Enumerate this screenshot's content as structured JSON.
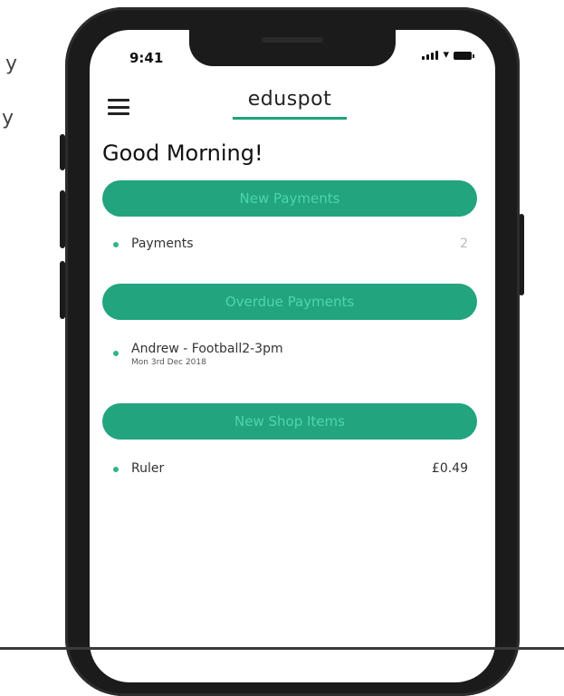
{
  "background_fragments": [
    "y",
    "y"
  ],
  "status_bar": {
    "time": "9:41",
    "signal_icon": "cellular-signal-icon",
    "wifi_icon": "wifi-icon",
    "battery_icon": "battery-icon"
  },
  "header": {
    "menu_icon": "hamburger-menu-icon",
    "logo": "eduspot"
  },
  "greeting": "Good Morning!",
  "sections": [
    {
      "button_label": "New Payments",
      "items": [
        {
          "label": "Payments",
          "value": "2"
        }
      ]
    },
    {
      "button_label": "Overdue Payments",
      "items": [
        {
          "label": "Andrew - Football2-3pm",
          "sub": "Mon 3rd Dec 2018"
        }
      ]
    },
    {
      "button_label": "New Shop Items",
      "items": [
        {
          "label": "Ruler",
          "value": "£0.49"
        }
      ]
    }
  ],
  "colors": {
    "accent": "#22a47f",
    "button_text": "#4cd6ac",
    "bullet": "#2fb48a",
    "phone_frame": "#1b1b1b"
  }
}
